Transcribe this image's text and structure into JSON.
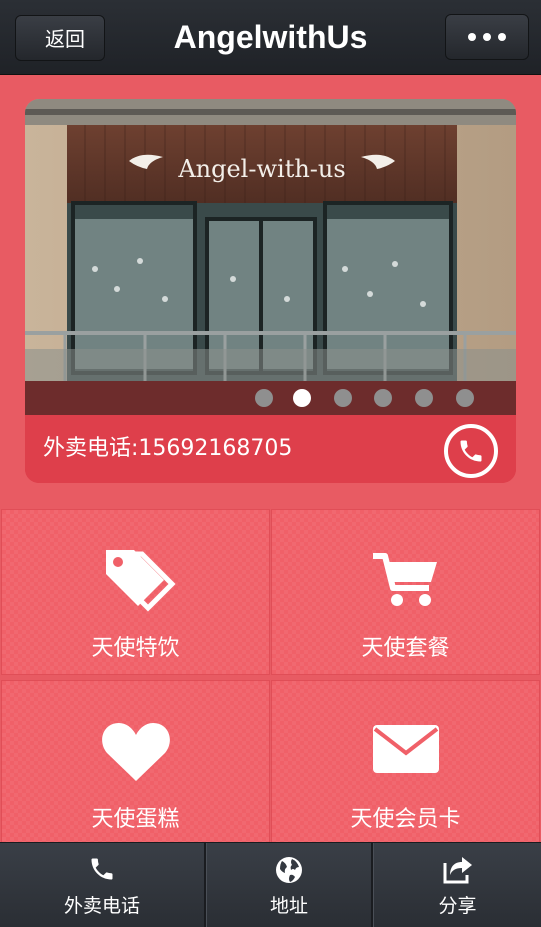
{
  "header": {
    "back_label": "返回",
    "title": "AngelwithUs",
    "more_icon": "more-dots-icon"
  },
  "banner": {
    "sign_text": "Angel-with-us",
    "slide_count": 6,
    "active_slide": 2,
    "phone_text": "外卖电话:15692168705",
    "phone_icon": "phone-icon"
  },
  "menu": {
    "items": [
      {
        "label": "天使特饮",
        "icon": "tags-icon"
      },
      {
        "label": "天使套餐",
        "icon": "cart-icon"
      },
      {
        "label": "天使蛋糕",
        "icon": "heart-icon"
      },
      {
        "label": "天使会员卡",
        "icon": "envelope-icon"
      }
    ]
  },
  "bottom_nav": {
    "items": [
      {
        "label": "外卖电话",
        "icon": "phone-icon"
      },
      {
        "label": "地址",
        "icon": "globe-icon"
      },
      {
        "label": "分享",
        "icon": "share-icon"
      }
    ]
  },
  "colors": {
    "accent": "#e85b63",
    "strip": "#de3f4b",
    "bar": "#2b2f35"
  }
}
